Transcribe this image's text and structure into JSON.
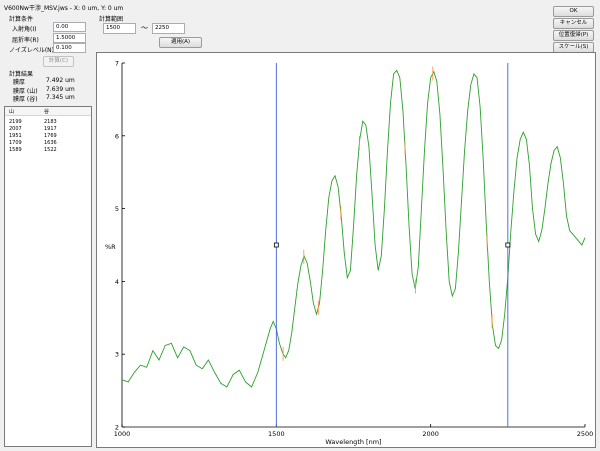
{
  "window": {
    "title": "V600Nw干渉_MSV.jws - X: 0 um, Y: 0 um"
  },
  "conditions": {
    "heading": "計算条件",
    "incidence_label": "入射角(I)",
    "incidence_value": "0.00",
    "refractive_label": "屈折率(R)",
    "refractive_value": "1.5000",
    "noise_label": "ノイズレベル(N)",
    "noise_value": "0.100",
    "calc_button": "計算(C)"
  },
  "results": {
    "heading": "計算結果",
    "rows": [
      {
        "label": "膜厚",
        "value": "7.492 um"
      },
      {
        "label": "膜厚 (山)",
        "value": "7.639 um"
      },
      {
        "label": "膜厚 (谷)",
        "value": "7.345 um"
      }
    ]
  },
  "table": {
    "headers": [
      "山",
      "谷"
    ],
    "rows": [
      [
        "2199",
        "2183"
      ],
      [
        "2007",
        "1917"
      ],
      [
        "1951",
        "1769"
      ],
      [
        "1709",
        "1636"
      ],
      [
        "1589",
        "1522"
      ]
    ]
  },
  "range": {
    "heading": "計算範囲",
    "start": "1500",
    "tilde": "〜",
    "end": "2250",
    "apply_button": "適用(A)"
  },
  "buttons": {
    "ok": "OK",
    "cancel": "キャンセル",
    "position_reset": "位置復帰(P)",
    "scale": "スケール(S)"
  },
  "chart_data": {
    "type": "line",
    "title": "",
    "xlabel": "Wavelength [nm]",
    "ylabel": "%R",
    "xlim": [
      1000,
      2500
    ],
    "ylim": [
      2,
      7
    ],
    "xticks": [
      "1000",
      "1500",
      "2000",
      "2500"
    ],
    "yticks": [
      "2",
      "3",
      "4",
      "5",
      "6",
      "7"
    ],
    "grid": false,
    "series": [
      {
        "color": "#2ca02c",
        "x": [
          1000,
          1020,
          1040,
          1060,
          1080,
          1100,
          1120,
          1140,
          1160,
          1180,
          1200,
          1220,
          1240,
          1260,
          1280,
          1300,
          1320,
          1340,
          1360,
          1380,
          1400,
          1420,
          1440,
          1460,
          1480,
          1490,
          1500,
          1510,
          1520,
          1530,
          1540,
          1550,
          1560,
          1570,
          1580,
          1590,
          1600,
          1610,
          1620,
          1630,
          1640,
          1650,
          1660,
          1670,
          1680,
          1690,
          1700,
          1710,
          1720,
          1730,
          1740,
          1750,
          1760,
          1770,
          1780,
          1790,
          1800,
          1810,
          1820,
          1830,
          1840,
          1850,
          1860,
          1870,
          1880,
          1890,
          1900,
          1910,
          1920,
          1930,
          1940,
          1950,
          1960,
          1970,
          1980,
          1990,
          2000,
          2010,
          2020,
          2030,
          2040,
          2050,
          2060,
          2070,
          2080,
          2090,
          2100,
          2110,
          2120,
          2130,
          2140,
          2150,
          2160,
          2170,
          2180,
          2190,
          2200,
          2210,
          2220,
          2230,
          2240,
          2250,
          2260,
          2270,
          2280,
          2290,
          2300,
          2310,
          2320,
          2330,
          2340,
          2350,
          2360,
          2370,
          2380,
          2390,
          2400,
          2410,
          2420,
          2430,
          2440,
          2450,
          2460,
          2470,
          2480,
          2490,
          2500
        ],
        "y": [
          2.65,
          2.62,
          2.75,
          2.85,
          2.82,
          3.05,
          2.92,
          3.12,
          3.15,
          2.95,
          3.1,
          3.05,
          2.85,
          2.8,
          2.92,
          2.75,
          2.6,
          2.55,
          2.72,
          2.78,
          2.62,
          2.55,
          2.75,
          3.05,
          3.35,
          3.45,
          3.35,
          3.15,
          3.02,
          2.95,
          3.05,
          3.3,
          3.65,
          3.98,
          4.22,
          4.35,
          4.25,
          4.0,
          3.7,
          3.55,
          3.7,
          4.15,
          4.7,
          5.15,
          5.38,
          5.45,
          5.3,
          4.9,
          4.4,
          4.05,
          4.15,
          4.75,
          5.45,
          5.95,
          6.2,
          6.15,
          5.85,
          5.2,
          4.5,
          4.15,
          4.35,
          5.0,
          5.8,
          6.45,
          6.85,
          6.9,
          6.8,
          6.35,
          5.6,
          4.75,
          4.1,
          3.9,
          4.2,
          5.0,
          5.8,
          6.45,
          6.8,
          6.88,
          6.75,
          6.3,
          5.55,
          4.7,
          4.0,
          3.8,
          3.9,
          4.4,
          5.1,
          5.8,
          6.35,
          6.7,
          6.85,
          6.8,
          6.4,
          5.7,
          4.8,
          4.0,
          3.4,
          3.12,
          3.08,
          3.2,
          3.55,
          4.05,
          4.7,
          5.25,
          5.7,
          5.95,
          6.05,
          5.95,
          5.6,
          5.0,
          4.65,
          4.55,
          4.7,
          5.0,
          5.35,
          5.62,
          5.8,
          5.85,
          5.7,
          5.35,
          4.9,
          4.7,
          4.65,
          4.6,
          4.55,
          4.5,
          4.6
        ]
      }
    ],
    "peaks_valleys_x": [
      1589,
      1709,
      1951,
      2007,
      2199,
      1522,
      1636,
      1769,
      1917,
      2183
    ],
    "range_lines_x": [
      1500,
      2250
    ]
  }
}
